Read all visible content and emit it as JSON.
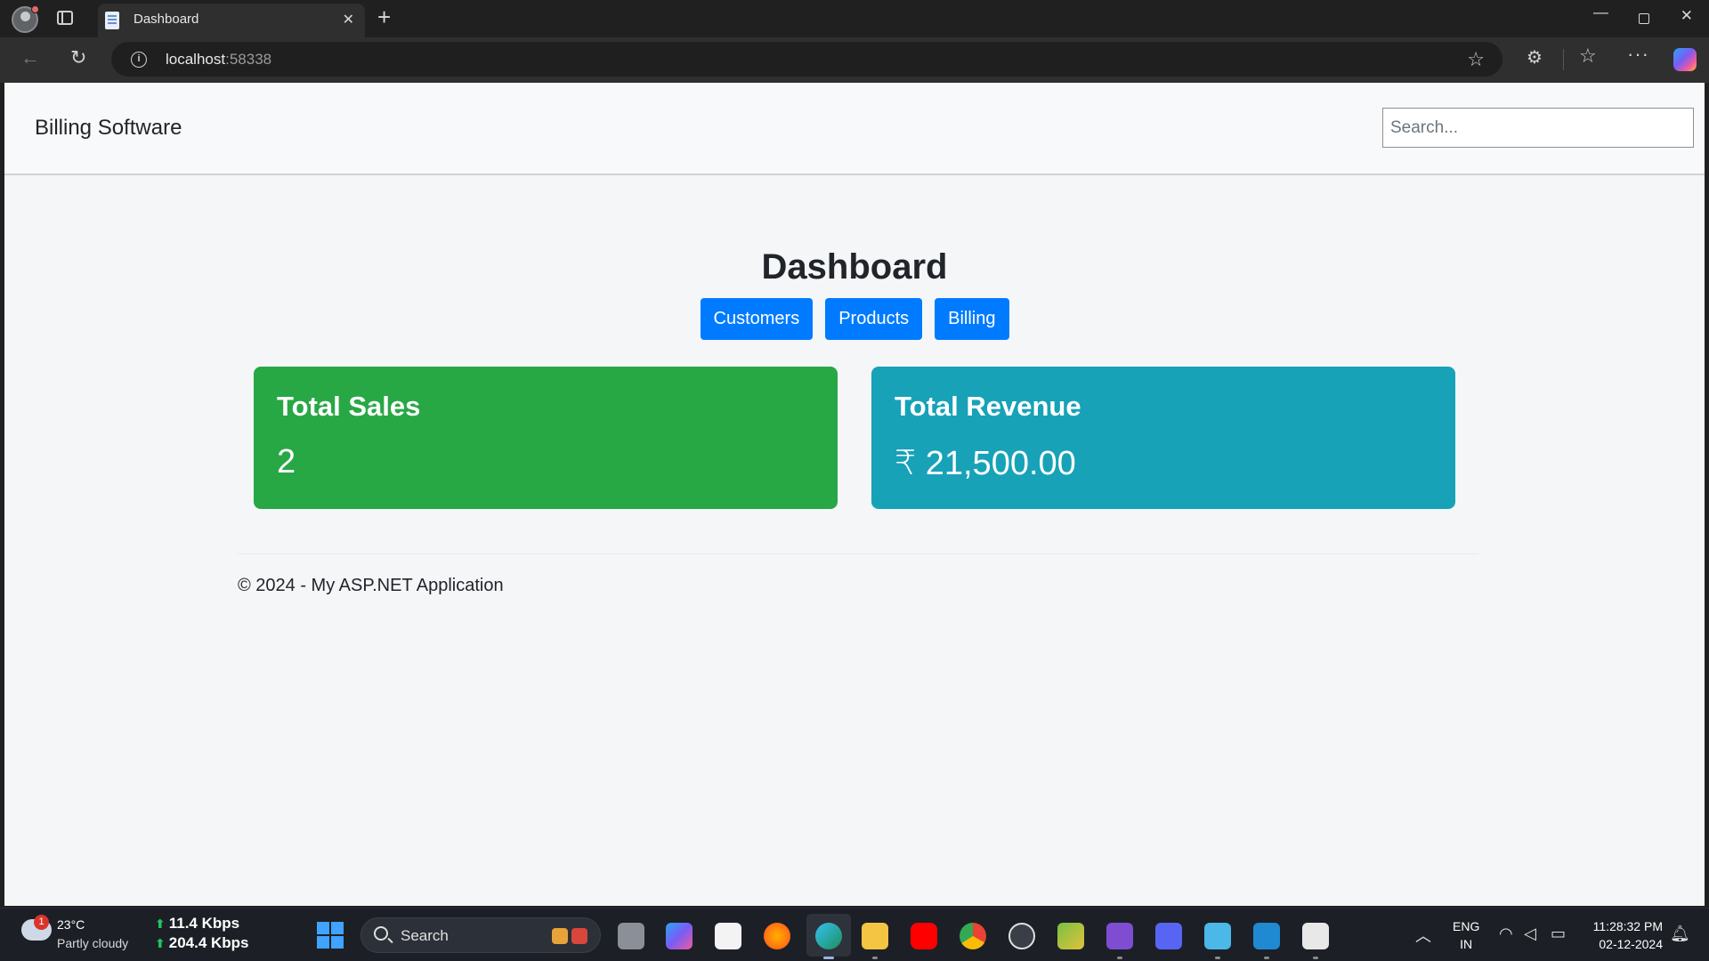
{
  "browser": {
    "tab_title": "Dashboard",
    "url_host": "localhost",
    "url_port": ":58338"
  },
  "navbar": {
    "brand": "Billing Software",
    "search_placeholder": "Search..."
  },
  "main": {
    "title": "Dashboard",
    "nav_buttons": [
      "Customers",
      "Products",
      "Billing"
    ],
    "cards": [
      {
        "title": "Total Sales",
        "value": "2",
        "color": "#28a745"
      },
      {
        "title": "Total Revenue",
        "value": "₹ 21,500.00",
        "color": "#17a2b8"
      }
    ]
  },
  "footer": {
    "text": "© 2024 - My ASP.NET Application"
  },
  "taskbar": {
    "weather_badge": "1",
    "weather_temp": "23°C",
    "weather_desc": "Partly cloudy",
    "net_upload": "11.4 Kbps",
    "net_download": "204.4 Kbps",
    "search_label": "Search",
    "lang_primary": "ENG",
    "lang_region": "IN",
    "time": "11:28:32 PM",
    "date": "02-12-2024"
  },
  "colors": {
    "primary_button": "#007bff",
    "page_bg": "#f4f6f8",
    "navbar_bg": "#f8f9fa"
  }
}
